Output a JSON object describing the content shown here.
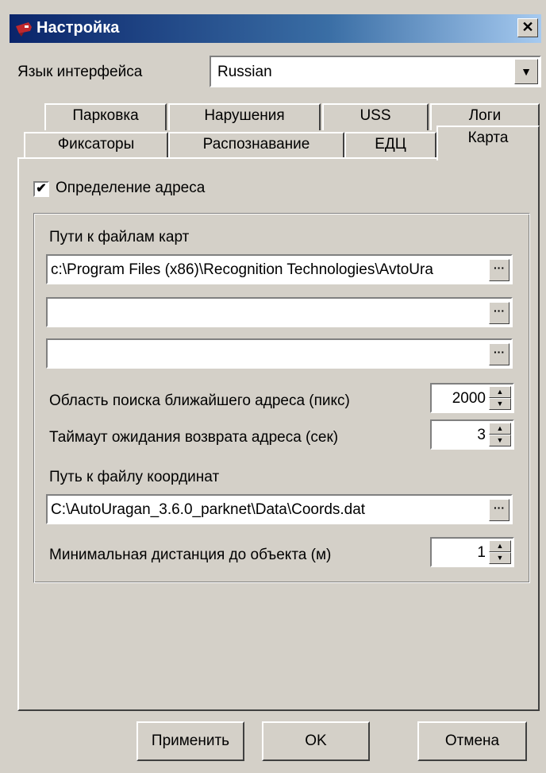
{
  "window": {
    "title": "Настройка",
    "close_symbol": "✕",
    "icon": "app-icon"
  },
  "language": {
    "label": "Язык интерфейса",
    "value": "Russian",
    "dropdown_symbol": "▼"
  },
  "tabs_back_row": [
    "Парковка",
    "Нарушения",
    "USS",
    "Логи"
  ],
  "tabs_front_row": [
    "Фиксаторы",
    "Распознавание",
    "ЕДЦ",
    "Карта"
  ],
  "active_tab": "Карта",
  "map_tab": {
    "address_detection": {
      "label": "Определение адреса",
      "checked": true,
      "check_symbol": "✔"
    },
    "map_files_label": "Пути к файлам карт",
    "map_file_paths": [
      "c:\\Program Files (x86)\\Recognition Technologies\\AvtoUra",
      "",
      ""
    ],
    "browse_symbol": "···",
    "search_area": {
      "label": "Область поиска ближайшего адреса (пикс)",
      "value": "2000"
    },
    "timeout": {
      "label": "Таймаут ожидания возврата адреса (сек)",
      "value": "3"
    },
    "coords_file": {
      "label": "Путь к файлу координат",
      "value": "C:\\AutoUragan_3.6.0_parknet\\Data\\Coords.dat"
    },
    "min_distance": {
      "label": "Минимальная дистанция до объекта (м)",
      "value": "1"
    },
    "spin_up_symbol": "▲",
    "spin_down_symbol": "▼"
  },
  "buttons": {
    "apply": "Применить",
    "ok": "OK",
    "cancel": "Отмена"
  },
  "colors": {
    "face": "#d4d0c8",
    "titlebar_start": "#0a246a",
    "titlebar_end": "#a6caf0"
  }
}
